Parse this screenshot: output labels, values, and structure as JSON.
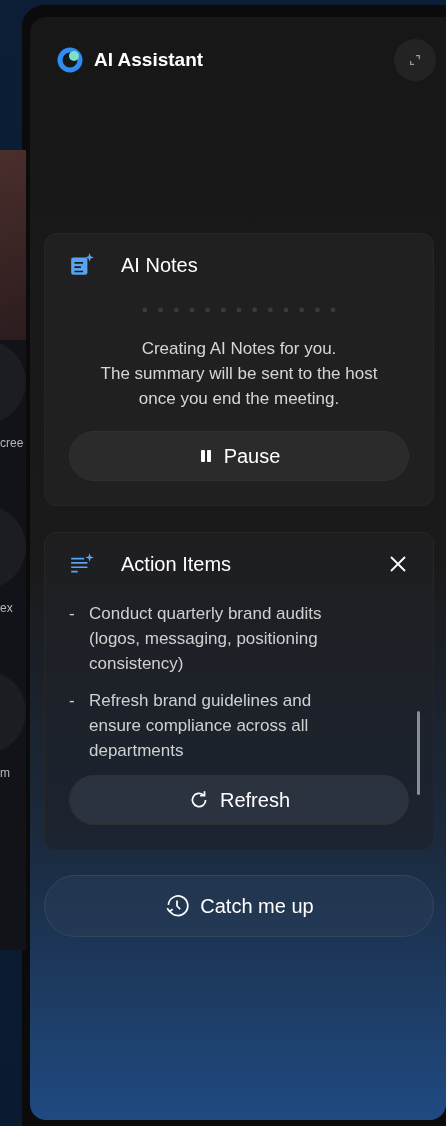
{
  "background": {
    "side_labels": [
      "cree",
      "ex",
      "m"
    ]
  },
  "panel": {
    "title": "AI Assistant"
  },
  "notes": {
    "title": "AI Notes",
    "message": "Creating AI Notes for you.\nThe summary will be sent to the host\nonce you end the meeting.",
    "button": "Pause"
  },
  "action_items": {
    "title": "Action Items",
    "items": [
      {
        "marker": "-",
        "text": "Conduct quarterly brand audits (logos, messaging, positioning consistency)"
      },
      {
        "marker": "-",
        "text": "Refresh brand guidelines and ensure compliance across all departments"
      }
    ],
    "button": "Refresh"
  },
  "catch_up": {
    "label": "Catch me up"
  }
}
